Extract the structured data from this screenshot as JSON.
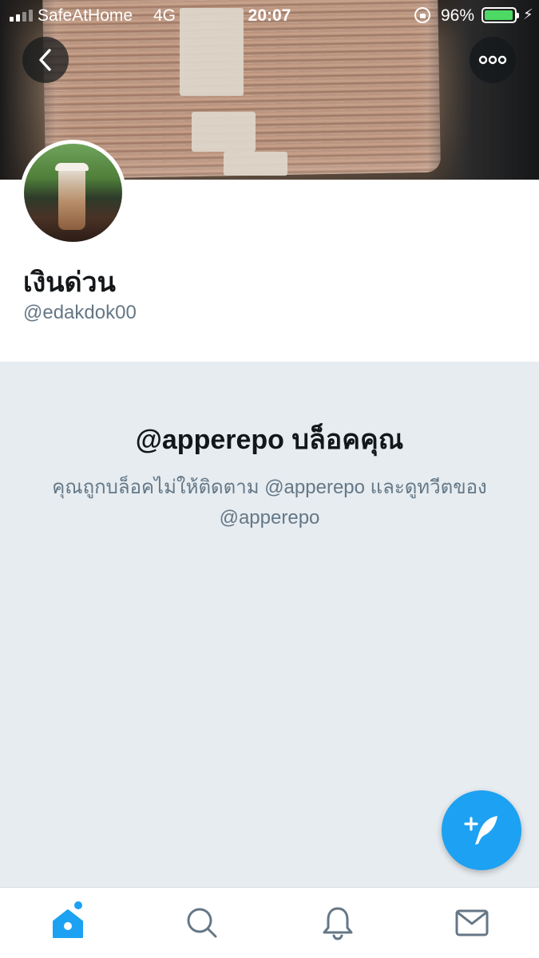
{
  "status_bar": {
    "carrier": "SafeAtHome",
    "network": "4G",
    "time": "20:07",
    "battery_percent": "96%",
    "battery_level": 0.96
  },
  "profile": {
    "display_name": "เงินด่วน",
    "handle": "@edakdok00"
  },
  "blocked": {
    "title": "@apperepo บล็อคคุณ",
    "description": "คุณถูกบล็อคไม่ให้ติดตาม @apperepo และดูทวีตของ @apperepo"
  },
  "icons": {
    "back": "chevron-left-icon",
    "more": "more-dots-icon",
    "compose": "compose-tweet-icon",
    "home": "home-icon",
    "search": "search-icon",
    "notifications": "bell-icon",
    "messages": "mail-icon"
  },
  "colors": {
    "accent": "#1da1f2",
    "background": "#e6ecf0",
    "secondary_text": "#657786",
    "battery": "#4cd964"
  }
}
